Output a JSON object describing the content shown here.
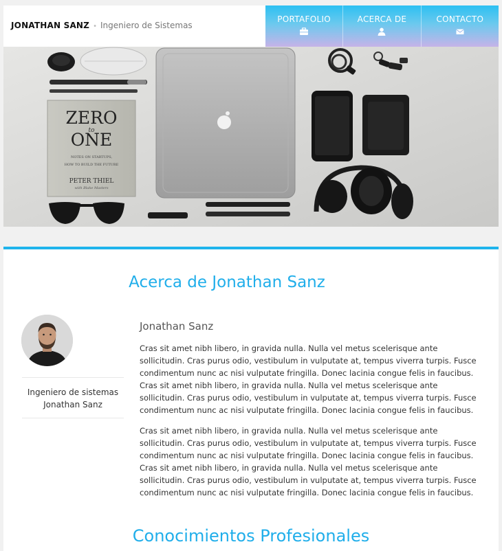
{
  "header": {
    "name": "JONATHAN SANZ",
    "separator": "•",
    "role": "Ingeniero de Sistemas"
  },
  "nav": {
    "items": [
      {
        "label": "PORTAFOLIO",
        "icon": "briefcase-icon"
      },
      {
        "label": "ACERCA DE",
        "icon": "user-icon"
      },
      {
        "label": "CONTACTO",
        "icon": "envelope-icon"
      }
    ]
  },
  "hero": {
    "book_line1": "ZERO",
    "book_line2": "to",
    "book_line3": "ONE",
    "book_subtitle1": "NOTES ON STARTUPS,",
    "book_subtitle2": "HOW TO BUILD THE FUTURE",
    "book_author": "PETER THIEL",
    "book_coauthor": "with Blake Masters"
  },
  "about": {
    "title": "Acerca de Jonathan Sanz",
    "caption_line1": "Ingeniero de sistemas",
    "caption_line2": "Jonathan Sanz",
    "bio_name": "Jonathan Sanz",
    "paragraph1": "Cras sit amet nibh libero, in gravida nulla. Nulla vel metus scelerisque ante sollicitudin. Cras purus odio, vestibulum in vulputate at, tempus viverra turpis. Fusce condimentum nunc ac nisi vulputate fringilla. Donec lacinia congue felis in faucibus. Cras sit amet nibh libero, in gravida nulla. Nulla vel metus scelerisque ante sollicitudin. Cras purus odio, vestibulum in vulputate at, tempus viverra turpis. Fusce condimentum nunc ac nisi vulputate fringilla. Donec lacinia congue felis in faucibus.",
    "paragraph2": "Cras sit amet nibh libero, in gravida nulla. Nulla vel metus scelerisque ante sollicitudin. Cras purus odio, vestibulum in vulputate at, tempus viverra turpis. Fusce condimentum nunc ac nisi vulputate fringilla. Donec lacinia congue felis in faucibus. Cras sit amet nibh libero, in gravida nulla. Nulla vel metus scelerisque ante sollicitudin. Cras purus odio, vestibulum in vulputate at, tempus viverra turpis. Fusce condimentum nunc ac nisi vulputate fringilla. Donec lacinia congue felis in faucibus."
  },
  "skills": {
    "title": "Conocimientos Profesionales"
  },
  "colors": {
    "accent": "#20aeea",
    "nav_gradient_top": "#2cc0f2",
    "nav_gradient_bottom": "#c6b3e8"
  }
}
